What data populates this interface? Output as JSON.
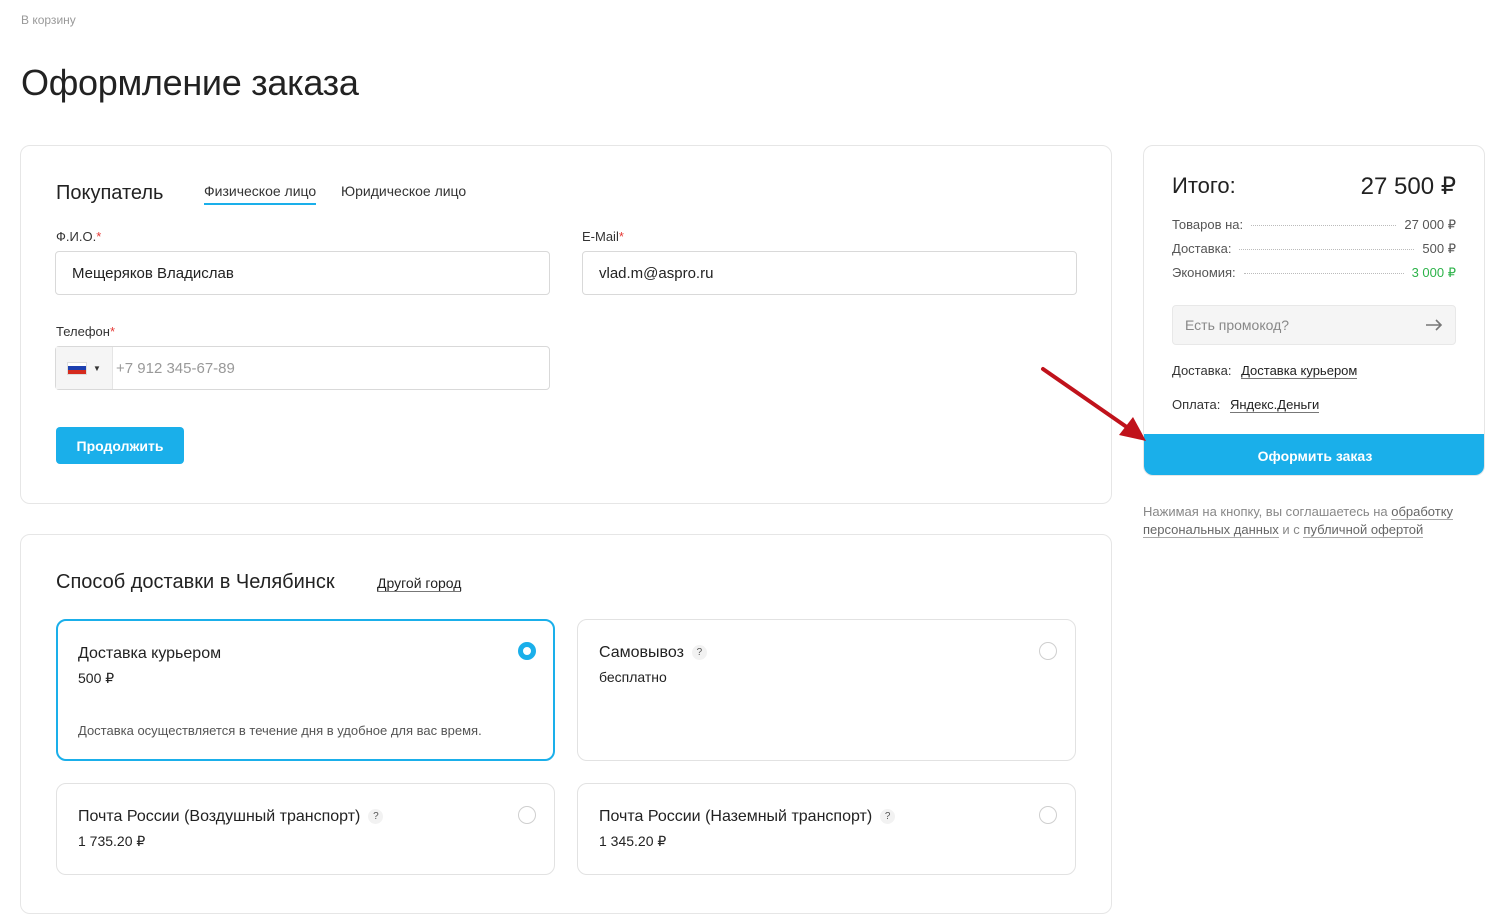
{
  "breadcrumb": "В корзину",
  "page_title": "Оформление заказа",
  "buyer": {
    "title": "Покупатель",
    "tabs": [
      "Физическое лицо",
      "Юридическое лицо"
    ],
    "fio_label": "Ф.И.О.",
    "fio_value": "Мещеряков Владислав",
    "email_label": "E-Mail",
    "email_value": "vlad.m@aspro.ru",
    "phone_label": "Телефон",
    "phone_placeholder": "+7 912 345-67-89",
    "required_mark": "*",
    "continue_label": "Продолжить"
  },
  "delivery": {
    "title": "Способ доставки в Челябинск",
    "other_city": "Другой город",
    "help_mark": "?",
    "options": [
      {
        "title": "Доставка курьером",
        "price": "500 ₽",
        "desc": "Доставка осуществляется в течение дня в удобное для вас время."
      },
      {
        "title": "Самовывоз",
        "price": "бесплатно"
      },
      {
        "title": "Почта России (Воздушный транспорт)",
        "price": "1 735.20 ₽"
      },
      {
        "title": "Почта России (Наземный транспорт)",
        "price": "1 345.20 ₽"
      }
    ]
  },
  "summary": {
    "total_label": "Итого:",
    "total_value": "27 500 ₽",
    "rows": [
      {
        "label": "Товаров на:",
        "value": "27 000 ₽"
      },
      {
        "label": "Доставка:",
        "value": "500 ₽"
      },
      {
        "label": "Экономия:",
        "value": "3 000 ₽"
      }
    ],
    "promo_placeholder": "Есть промокод?",
    "delivery_label": "Доставка:",
    "delivery_value": "Доставка курьером",
    "payment_label": "Оплата:",
    "payment_value": "Яндекс.Деньги",
    "submit_label": "Оформить заказ",
    "economy_color": "#2db34a"
  },
  "agreement": {
    "text1": "Нажимая на кнопку, вы соглашаетесь на ",
    "link1": "обработку персональных данных",
    "text2": " и с ",
    "link2": "публичной офертой"
  },
  "accent_color": "#1aafea",
  "arrow_color": "#c0121b",
  "icons": [
    "russia-flag-icon",
    "caret-down-icon",
    "arrow-right-icon",
    "radio-icon",
    "help-icon",
    "annotation-arrow-icon"
  ]
}
